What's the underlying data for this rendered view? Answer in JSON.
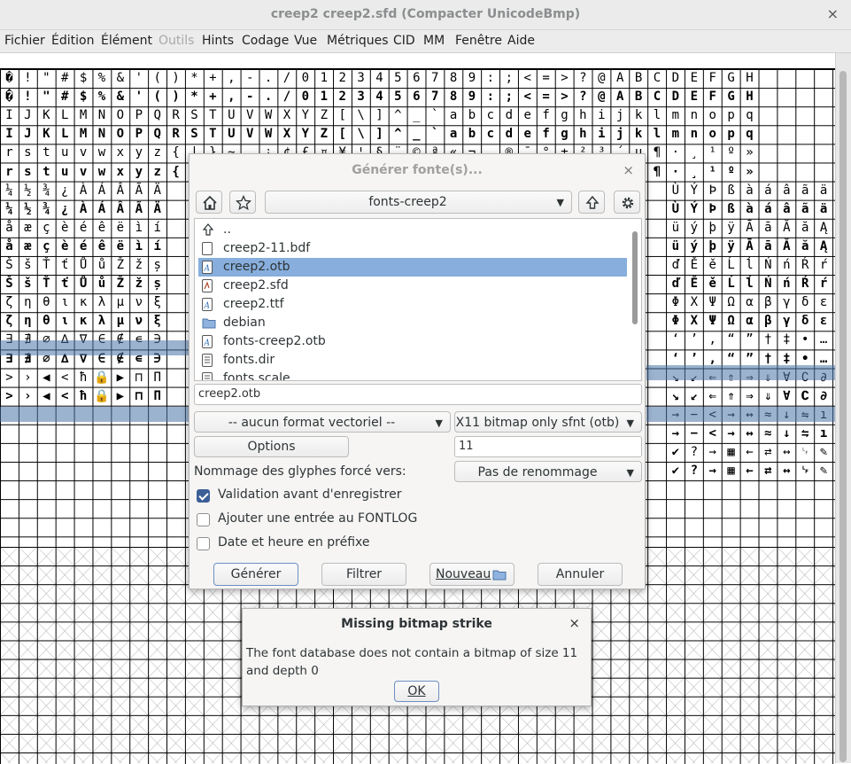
{
  "window": {
    "title": "creep2  creep2.sfd (Compacter UnicodeBmp)",
    "close_glyph": "×"
  },
  "menu": [
    {
      "label": "Fichier",
      "enabled": true
    },
    {
      "label": "Édition",
      "enabled": true
    },
    {
      "label": "Élément",
      "enabled": true
    },
    {
      "label": "Outils",
      "enabled": false
    },
    {
      "label": "Hints",
      "enabled": true
    },
    {
      "label": "Codage",
      "enabled": true
    },
    {
      "label": "Vue",
      "enabled": true
    },
    {
      "label": "Métriques",
      "enabled": true
    },
    {
      "label": "CID",
      "enabled": true
    },
    {
      "label": "MM",
      "enabled": true
    },
    {
      "label": "Fenêtre",
      "enabled": true
    },
    {
      "label": "Aide",
      "enabled": true
    }
  ],
  "grid": {
    "header_row_1": [
      "�",
      "!",
      "\"",
      "#",
      "$",
      "%",
      "&",
      "'",
      "(",
      ")",
      "*",
      "+",
      ",",
      "-",
      ".",
      "/",
      "0",
      "1",
      "2",
      "3",
      "4",
      "5",
      "6",
      "7",
      "8",
      "9",
      ":",
      ";",
      "<",
      "=",
      ">",
      "?",
      "@",
      "A",
      "B",
      "C",
      "D",
      "E",
      "F",
      "G",
      "H"
    ],
    "header_row_2": [
      "I",
      "J",
      "K",
      "L",
      "M",
      "N",
      "O",
      "P",
      "Q",
      "R",
      "S",
      "T",
      "U",
      "V",
      "W",
      "X",
      "Y",
      "Z",
      "[",
      "\\",
      "]",
      "^",
      "_",
      "`",
      "a",
      "b",
      "c",
      "d",
      "e",
      "f",
      "g",
      "h",
      "i",
      "j",
      "k",
      "l",
      "m",
      "n",
      "o",
      "p",
      "q"
    ],
    "header_row_3": [
      "r",
      "s",
      "t",
      "u",
      "v",
      "w",
      "x",
      "y",
      "z",
      "{",
      "|",
      "}",
      "~",
      "",
      "¡",
      "¢",
      "£",
      "¤",
      "¥",
      "¦",
      "§",
      "¨",
      "©",
      "ª",
      "«",
      "¬",
      "",
      "®",
      "¯",
      "°",
      "±",
      "²",
      "³",
      "´",
      "µ",
      "¶",
      "·",
      "¸",
      "¹",
      "º",
      "»"
    ],
    "right_col_rows": [
      [
        "Ù",
        "Ý",
        "Þ",
        "ß",
        "à",
        "á",
        "â",
        "ã",
        "ä"
      ],
      [
        "ü",
        "ý",
        "þ",
        "ÿ",
        "Ā",
        "ā",
        "Ă",
        "ă",
        "Ą"
      ],
      [
        "ď",
        "Ě",
        "ě",
        "Ĺ",
        "ĺ",
        "Ń",
        "ń",
        "Ŕ",
        "ŕ"
      ],
      [
        "Φ",
        "Χ",
        "Ψ",
        "Ω",
        "α",
        "β",
        "γ",
        "δ",
        "ε"
      ],
      [
        "‘",
        "’",
        "‚",
        "“",
        "”",
        "†",
        "‡",
        "•",
        "…"
      ],
      [
        "↘",
        "↙",
        "⇐",
        "⇑",
        "⇒",
        "⇓",
        "∀",
        "∁",
        "∂"
      ],
      [
        "→",
        "−",
        "<",
        "→",
        "↔",
        "≈",
        "↓",
        "⇋",
        "ı"
      ],
      [
        "✔",
        "?",
        "→",
        "▦",
        "←",
        "⇄",
        "↔",
        "␊",
        "✎"
      ]
    ],
    "left_col_rows": [
      [
        "¼",
        "½",
        "¾",
        "¿",
        "À",
        "Á",
        "Â",
        "Ã",
        "Ä"
      ],
      [
        "å",
        "æ",
        "ç",
        "è",
        "é",
        "ê",
        "ë",
        "ì",
        "í"
      ],
      [
        "Š",
        "š",
        "Ť",
        "ť",
        "Ů",
        "ů",
        "Ž",
        "ž",
        "ș"
      ],
      [
        "ζ",
        "η",
        "θ",
        "ι",
        "κ",
        "λ",
        "μ",
        "ν",
        "ξ"
      ],
      [
        "∃",
        "∄",
        "∅",
        "∆",
        "∇",
        "∈",
        "∉",
        "∊",
        "∋"
      ],
      [
        ">",
        "›",
        "◀",
        "<",
        "ħ",
        "🔒",
        "▶",
        "⊓",
        "Π"
      ]
    ]
  },
  "generate_dialog": {
    "title": "Générer fonte(s)...",
    "close_glyph": "×",
    "folder": "fonts-creep2",
    "home_icon": "home-icon",
    "bookmark_icon": "star-icon",
    "up_icon": "arrow-up-icon",
    "settings_icon": "gear-icon",
    "files": [
      {
        "name": "..",
        "icon": "parent-dir-icon",
        "selected": false
      },
      {
        "name": "creep2-11.bdf",
        "icon": "file-icon",
        "selected": false
      },
      {
        "name": "creep2.otb",
        "icon": "font-file-icon",
        "selected": true
      },
      {
        "name": "creep2.sfd",
        "icon": "sfd-file-icon",
        "selected": false
      },
      {
        "name": "creep2.ttf",
        "icon": "font-file-icon",
        "selected": false
      },
      {
        "name": "debian",
        "icon": "folder-icon",
        "selected": false
      },
      {
        "name": "fonts-creep2.otb",
        "icon": "font-file-icon",
        "selected": false
      },
      {
        "name": "fonts.dir",
        "icon": "text-file-icon",
        "selected": false
      },
      {
        "name": "fonts.scale",
        "icon": "text-file-icon",
        "selected": false
      }
    ],
    "filename": "creep2.otb",
    "outline_format": "-- aucun format vectoriel --",
    "bitmap_format": "X11 bitmap only sfnt (otb)",
    "options_label": "Options",
    "bitmap_sizes": "11",
    "glyph_naming_label": "Nommage des glyphes forcé vers:",
    "glyph_naming_value": "Pas de renommage",
    "validate_label": "Validation avant d'enregistrer",
    "validate_checked": true,
    "fontlog_label": "Ajouter une entrée au FONTLOG",
    "fontlog_checked": false,
    "date_label": "Date et heure en préfixe",
    "date_checked": false,
    "generate_label": "Générer",
    "filter_label": "Filtrer",
    "new_label": "Nouveau",
    "cancel_label": "Annuler"
  },
  "missing_dialog": {
    "title": "Missing bitmap strike",
    "close_glyph": "×",
    "message": "The font database does not contain a bitmap of size 11 and depth 0",
    "ok_label": "OK"
  }
}
